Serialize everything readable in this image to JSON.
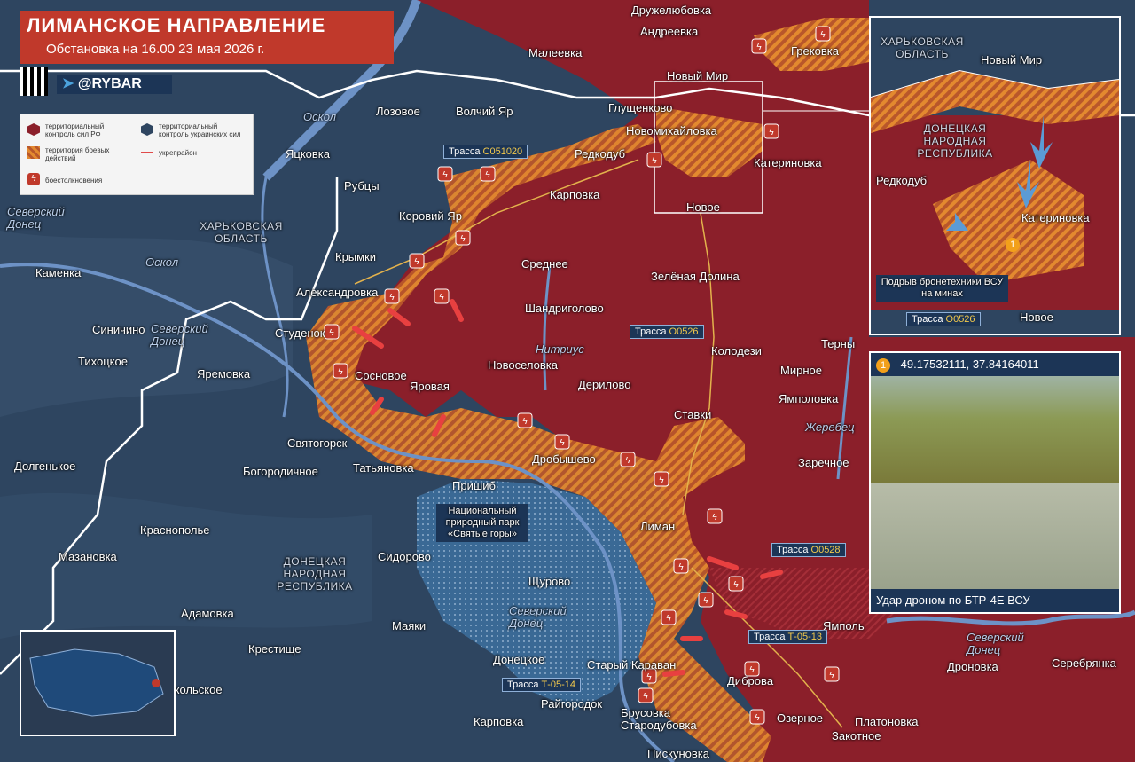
{
  "header": {
    "title": "ЛИМАНСКОЕ НАПРАВЛЕНИЕ",
    "subtitle": "Обстановка на 16.00 23 мая 2026 г.",
    "brand": "@RYBAR"
  },
  "legend": {
    "ru_control": "территориальный контроль сил РФ",
    "ua_control": "территориальный контроль украинских сил",
    "combat": "территория боевых действий",
    "fortline": "укрепрайон",
    "clashes": "боестолкновения"
  },
  "colors": {
    "ru": "#8b1f2a",
    "ua": "#2e4560",
    "combat": "#e3892f",
    "accent": "#c0392b",
    "navy": "#1c3556"
  },
  "regions": {
    "kharkiv": "ХАРЬКОВСКАЯ ОБЛАСТЬ",
    "donetsk": "ДОНЕЦКАЯ НАРОДНАЯ РЕСПУБЛИКА"
  },
  "rivers": {
    "oskol1": "Оскол",
    "oskol2": "Оскол",
    "sev_donets1": "Северский Донец",
    "sev_donets2": "Северский Донец",
    "sev_donets3": "Северский Донец",
    "sev_donets4": "Северский Донец",
    "nitrius": "Нитриус",
    "zherebets": "Жеребец"
  },
  "roads": {
    "c051020": {
      "prefix": "Трасса ",
      "code": "С051020"
    },
    "o0526": {
      "prefix": "Трасса ",
      "code": "О0526"
    },
    "o0528": {
      "prefix": "Трасса ",
      "code": "О0528"
    },
    "t0513": {
      "prefix": "Трасса ",
      "code": "Т-05-13"
    },
    "t0514": {
      "prefix": "Трасса ",
      "code": "Т-05-14"
    }
  },
  "places": [
    "Дружелюбовка",
    "Андреевка",
    "Малеевка",
    "Грековка",
    "Новый Мир",
    "Глущенково",
    "Новомихайловка",
    "Катериновка",
    "Редкодуб",
    "Карповка",
    "Новое",
    "Лозовое",
    "Волчий Яр",
    "Яцковка",
    "Рубцы",
    "Коровий Яр",
    "Крымки",
    "Среднее",
    "Александровка",
    "Зелёная Долина",
    "Шандриголово",
    "Студенок",
    "Каменка",
    "Синичино",
    "Тихоцкое",
    "Яремовка",
    "Сосновое",
    "Яровая",
    "Новоселовка",
    "Дерилово",
    "Колодези",
    "Терны",
    "Мирное",
    "Ямполовка",
    "Ставки",
    "Святогорск",
    "Татьяновка",
    "Богородичное",
    "Долгенькое",
    "Дробышево",
    "Заречное",
    "Пришиб",
    "Лиман",
    "Краснополье",
    "Мазановка",
    "Сидорово",
    "Щурово",
    "Адамовка",
    "Маяки",
    "Крестище",
    "Донецкое",
    "Старый Караван",
    "Ямполь",
    "Никольское",
    "Дибровa",
    "Райгородок",
    "Брусовка",
    "Карповка",
    "Стародубовка",
    "Озерное",
    "Платоновка",
    "Дроновка",
    "Серебрянка",
    "Закотное",
    "Пискуновка"
  ],
  "park": "Национальный природный парк «Святые горы»",
  "inset": {
    "region_kharkiv": "ХАРЬКОВСКАЯ ОБЛАСТЬ",
    "region_donetsk": "ДОНЕЦКАЯ НАРОДНАЯ РЕСПУБЛИКА",
    "novy_mir": "Новый Мир",
    "redkodub": "Редкодуб",
    "katerinovka": "Катериновка",
    "novoe": "Новое",
    "mines": "Подрыв бронетехники ВСУ на минах",
    "road_prefix": "Трасса ",
    "road_code": "О0526",
    "marker": "1"
  },
  "video": {
    "marker": "1",
    "coords": "49.17532111, 37.84164011",
    "caption": "Удар дроном по БТР-4Е ВСУ"
  }
}
